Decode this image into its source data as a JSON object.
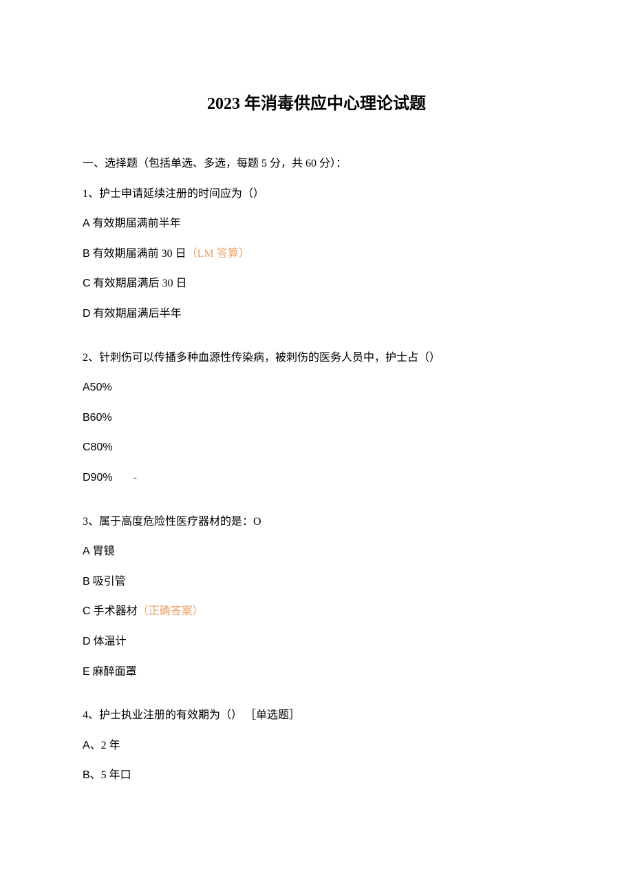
{
  "title": "2023 年消毒供应中心理论试题",
  "section_header": "一、选择题（包括单选、多选，每题 5 分，共 60 分）：",
  "q1": {
    "stem": "1、护士申请延续注册的时间应为（）",
    "a_prefix": "A",
    "a_text": " 有效期届满前半年",
    "b_prefix": "B",
    "b_text": " 有效期届满前 30 日",
    "b_answer": "（LM 答算）",
    "c_prefix": "C",
    "c_text": " 有效期届满后 30 日",
    "d_prefix": "D",
    "d_text": " 有效期届满后半年"
  },
  "q2": {
    "stem": "2、针刺伤可以传播多种血源性传染病，被刺伤的医务人员中，护士占（）",
    "a": "A50%",
    "b": "B60%",
    "c": "C80%",
    "d": "D90%",
    "d_dash": "-"
  },
  "q3": {
    "stem": "3、属于高度危险性医疗器材的是：O",
    "a_prefix": "A",
    "a_text": " 胃镜",
    "b_prefix": "B",
    "b_text": " 吸引管",
    "c_prefix": "C",
    "c_text": " 手术器材",
    "c_answer": "（正确答案）",
    "d_prefix": "D",
    "d_text": " 体温计",
    "e_prefix": "E",
    "e_text": " 麻醉面罩"
  },
  "q4": {
    "stem": "4、护士执业注册的有效期为（） ［单选题］",
    "a_prefix": "A",
    "a_text": "、2 年",
    "b_prefix": "B",
    "b_text": "、5 年口"
  }
}
